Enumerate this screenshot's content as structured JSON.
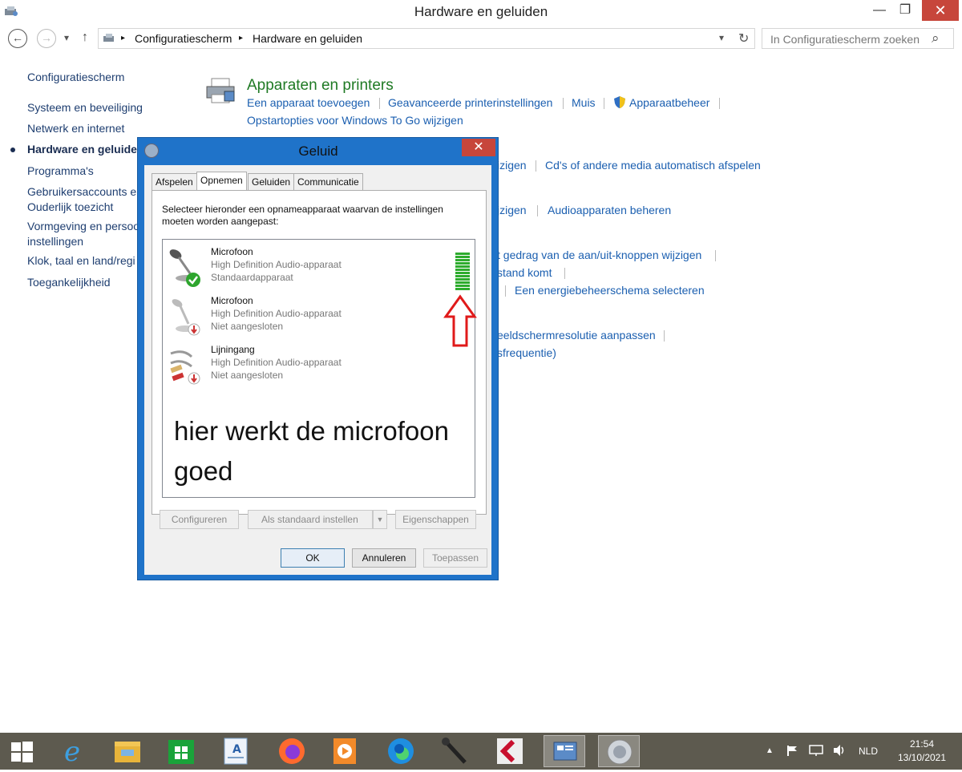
{
  "window": {
    "title": "Hardware en geluiden",
    "min": "—",
    "max": "❐",
    "close": "✕"
  },
  "address": {
    "back": "←",
    "forward": "→",
    "dropdown": "▾",
    "up": "↑",
    "crumbs": [
      "Configuratiescherm",
      "Hardware en geluiden"
    ],
    "sep": "▸",
    "refresh": "↻",
    "search_placeholder": "In Configuratiescherm zoeken",
    "search_icon": "⌕"
  },
  "leftnav": {
    "items": [
      "Configuratiescherm",
      "Systeem en beveiliging",
      "Netwerk en internet",
      "Hardware en geluiden",
      "Programma's",
      "Gebruikersaccounts en",
      "Ouderlijk toezicht",
      "Vormgeving en persoo",
      "instellingen",
      "Klok, taal en land/regi",
      "Toegankelijkheid"
    ]
  },
  "main": {
    "devices_title": "Apparaten en printers",
    "devices_links": [
      "Een apparaat toevoegen",
      "Geavanceerde printerinstellingen",
      "Muis",
      "Apparaatbeheer",
      "Opstartopties voor Windows To Go wijzigen"
    ],
    "autoplay_links": [
      "izigen",
      "Cd's of andere media automatisch afspelen"
    ],
    "sound_links": [
      "jzigen",
      "Audioapparaten beheren"
    ],
    "power_links": [
      "t gedrag van de aan/uit-knoppen wijzigen",
      "stand komt",
      "Een energiebeheerschema selecteren"
    ],
    "display_links": [
      "eeldschermresolutie aanpassen",
      "sfrequentie)"
    ]
  },
  "dialog": {
    "title": "Geluid",
    "close": "✕",
    "tabs": [
      "Afspelen",
      "Opnemen",
      "Geluiden",
      "Communicatie"
    ],
    "active_tab": "Opnemen",
    "instruction": "Selecteer hieronder een opnameapparaat waarvan de instellingen moeten worden aangepast:",
    "devices": [
      {
        "name": "Microfoon",
        "driver": "High Definition Audio-apparaat",
        "status": "Standaardapparaat"
      },
      {
        "name": "Microfoon",
        "driver": "High Definition Audio-apparaat",
        "status": "Niet aangesloten"
      },
      {
        "name": "Lijningang",
        "driver": "High Definition Audio-apparaat",
        "status": "Niet aangesloten"
      }
    ],
    "annotation_line1": "hier werkt de microfoon",
    "annotation_line2": "goed",
    "level_meter_bars": 12,
    "buttons": {
      "configure": "Configureren",
      "set_default": "Als standaard instellen",
      "properties": "Eigenschappen",
      "ok": "OK",
      "cancel": "Annuleren",
      "apply": "Toepassen"
    }
  },
  "taskbar": {
    "lang": "NLD",
    "time": "21:54",
    "date": "13/10/2021",
    "tray_up": "▲",
    "colors": {
      "bg": "#5d5a4f",
      "accent": "#1f73c9"
    }
  }
}
